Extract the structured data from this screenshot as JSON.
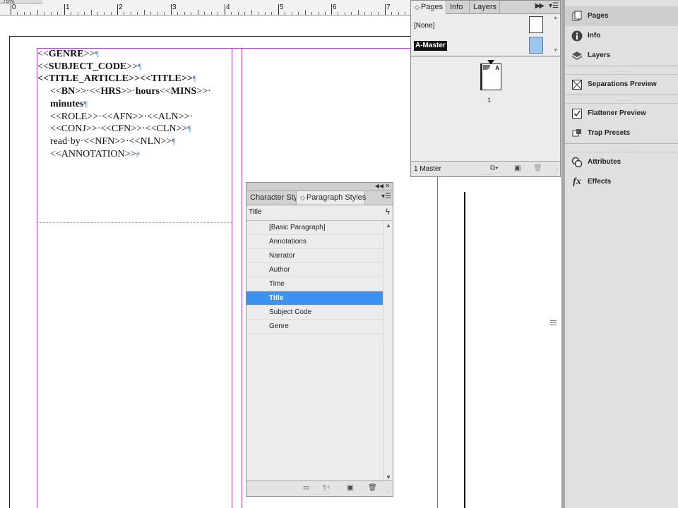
{
  "ruler": {
    "zoom_label": "75%",
    "numbers": [
      "0",
      "1",
      "2",
      "3",
      "4",
      "5",
      "6",
      "7"
    ]
  },
  "document": {
    "lines": [
      {
        "parts": [
          {
            "t": "<<"
          },
          {
            "t": "GENRE",
            "b": true
          },
          {
            "t": ">>"
          }
        ],
        "end": "¶",
        "indent": false
      },
      {
        "parts": [
          {
            "t": "<<"
          },
          {
            "t": "SUBJECT_CODE",
            "b": true
          },
          {
            "t": ">>"
          }
        ],
        "end": "¶",
        "indent": false
      },
      {
        "parts": [
          {
            "t": "<<TITLE_ARTICLE>><<TITLE>>",
            "b": true
          }
        ],
        "end": "¶",
        "indent": false
      },
      {
        "parts": [
          {
            "t": "<<"
          },
          {
            "t": "BN",
            "b": true
          },
          {
            "t": ">>·<<"
          },
          {
            "t": "HRS",
            "b": true
          },
          {
            "t": ">>·"
          },
          {
            "t": "hours",
            "b": true
          },
          {
            "t": "<<"
          },
          {
            "t": "MINS",
            "b": true
          },
          {
            "t": ">>·"
          }
        ],
        "end": "",
        "indent": true
      },
      {
        "parts": [
          {
            "t": "minutes",
            "b": true
          }
        ],
        "end": "¶",
        "indent": true
      },
      {
        "parts": [
          {
            "t": "<<ROLE>>·<<AFN>>·<<ALN>>·"
          }
        ],
        "end": "",
        "indent": true
      },
      {
        "parts": [
          {
            "t": "<<CONJ>>·<<CFN>>·<<CLN>>"
          }
        ],
        "end": "¶",
        "indent": true
      },
      {
        "parts": [
          {
            "t": "read·by·<<NFN>>·<<NLN>>"
          }
        ],
        "end": "¶",
        "indent": true
      },
      {
        "parts": [
          {
            "t": "<<ANNOTATION>>"
          }
        ],
        "end": "#",
        "indent": true
      }
    ]
  },
  "pages_panel": {
    "tabs": [
      "Pages",
      "Info",
      "Layers"
    ],
    "masters": [
      "[None]",
      "A-Master"
    ],
    "page_letter": "A",
    "page_number": "1",
    "footer_count": "1 Master"
  },
  "styles_panel": {
    "tabs": [
      "Character Sty",
      "Paragraph Styles"
    ],
    "current_style": "Title",
    "items": [
      "[Basic Paragraph]",
      "Annotations",
      "Narrator",
      "Author",
      "Time",
      "Title",
      "Subject Code",
      "Genre"
    ],
    "selected_index": 5
  },
  "dock": {
    "groups": [
      [
        "Pages",
        "Info",
        "Layers"
      ],
      [
        "Separations Preview"
      ],
      [
        "Flattener Preview",
        "Trap Presets"
      ],
      [
        "Attributes",
        "Effects"
      ]
    ]
  },
  "colors": {
    "guide": "#b24ec7",
    "selection": "#3d92f1",
    "pilcrow": "#5e90c9"
  }
}
